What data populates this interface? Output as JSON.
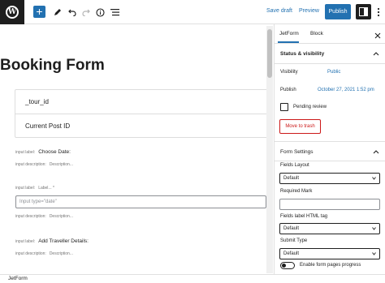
{
  "toolbar": {
    "logo_icon": "wordpress-logo-icon",
    "logo_glyph": "W",
    "add_label": "+",
    "save_draft": "Save draft",
    "preview": "Preview",
    "publish": "Publish"
  },
  "editor": {
    "title": "Booking Form",
    "field_rows": [
      "_tour_id",
      "Current Post ID"
    ],
    "fields": [
      {
        "label_prefix": "input label:",
        "label": "Choose Date:",
        "desc_prefix": "input description:",
        "desc": "Description..."
      },
      {
        "label_prefix": "input label:",
        "label": "Label... *",
        "placeholder": "Input type=\"date\"",
        "desc_prefix": "input description:",
        "desc": "Description..."
      },
      {
        "label_prefix": "input label:",
        "label": "Add Traveller Details:",
        "desc_prefix": "input description:",
        "desc": "Description..."
      }
    ]
  },
  "sidebar": {
    "tabs": [
      "JetForm",
      "Block"
    ],
    "status_panel": {
      "title": "Status & visibility",
      "visibility_label": "Visibility",
      "visibility_value": "Public",
      "publish_label": "Publish",
      "publish_value": "October 27, 2021 1:52 pm",
      "pending_review": "Pending review",
      "move_to_trash": "Move to trash"
    },
    "form_settings": {
      "title": "Form Settings",
      "fields_layout_label": "Fields Layout",
      "fields_layout_value": "Default",
      "required_mark_label": "Required Mark",
      "fields_label_tag_label": "Fields label HTML tag",
      "fields_label_tag_value": "Default",
      "submit_type_label": "Submit Type",
      "submit_type_value": "Default",
      "pages_progress_label": "Enable form pages progress"
    }
  },
  "footer": {
    "breadcrumb": "JetForm"
  },
  "colors": {
    "accent": "#2271b1",
    "danger": "#cc1818",
    "dark": "#1e1e1e"
  }
}
